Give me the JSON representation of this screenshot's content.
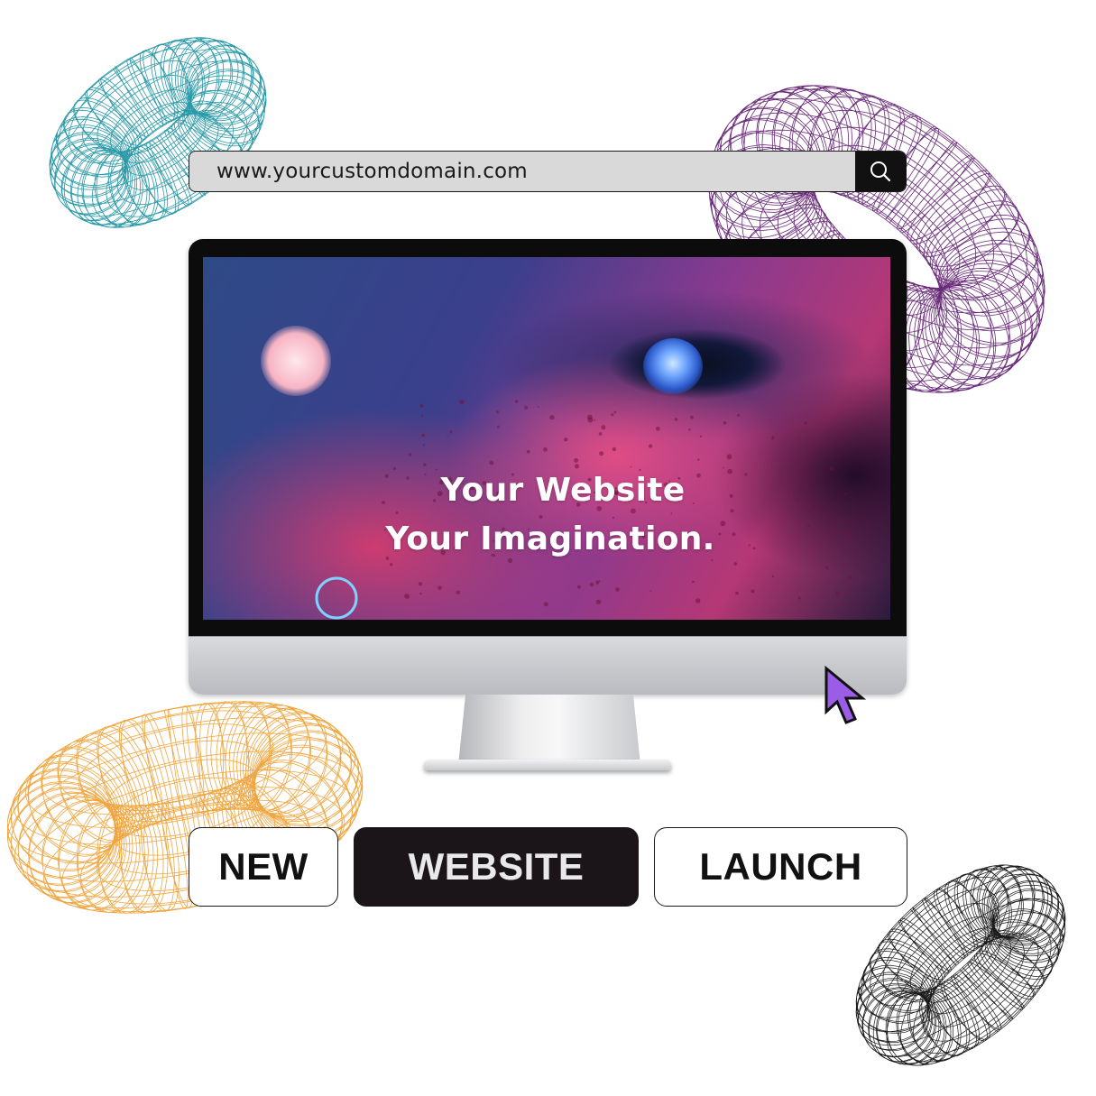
{
  "url_bar": {
    "url": "www.yourcustomdomain.com",
    "search_icon": "search-icon"
  },
  "screen": {
    "headline_line1": "Your Website",
    "headline_line2": "Your Imagination."
  },
  "buttons": {
    "new": "NEW",
    "website": "WEBSITE",
    "launch": "LAUNCH"
  },
  "colors": {
    "torus_teal": "#2a9aa8",
    "torus_purple": "#6a2c7a",
    "torus_orange": "#f0a640",
    "torus_black": "#1a1a1a",
    "cursor_purple": "#9b5de5",
    "website_button_bg": "#1b1519"
  },
  "icons": [
    "search-icon",
    "pointer-cursor-icon",
    "wireframe-torus-icon"
  ]
}
